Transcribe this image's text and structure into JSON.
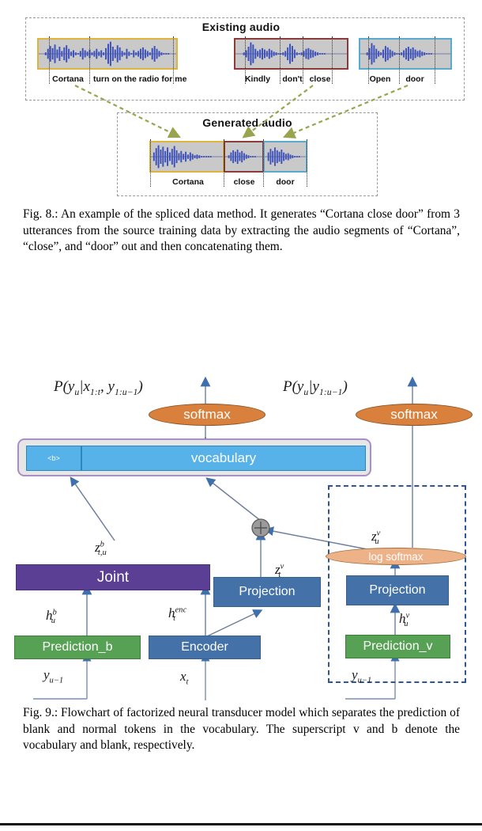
{
  "figure8": {
    "existing_audio": {
      "title": "Existing audio",
      "clips": [
        {
          "id": "clip-cortana",
          "border_color": "#e0b33c",
          "labels": [
            "Cortana",
            "turn on the radio for me"
          ]
        },
        {
          "id": "clip-kindly",
          "border_color": "#8c3a3a",
          "labels": [
            "Kindly",
            "don't",
            "close"
          ]
        },
        {
          "id": "clip-open",
          "border_color": "#5aa9cf",
          "labels": [
            "Open",
            "door"
          ]
        }
      ]
    },
    "generated_audio": {
      "title": "Generated audio",
      "segments": [
        {
          "id": "seg-cortana",
          "label": "Cortana",
          "border_color": "#e0b33c"
        },
        {
          "id": "seg-close",
          "label": "close",
          "border_color": "#8c3a3a"
        },
        {
          "id": "seg-door",
          "label": "door",
          "border_color": "#5aa9cf"
        }
      ]
    },
    "caption": "Fig. 8.: An example of the spliced data method. It generates “Cortana close door” from 3 utterances from the source training data by extracting the audio segments of “Cortana”, “close”, and “door” out and then concatenating them."
  },
  "figure9": {
    "nodes": {
      "softmax_left": "softmax",
      "softmax_right": "softmax",
      "log_softmax": "log softmax",
      "vocab_blank": "<b>",
      "vocab_main": "vocabulary",
      "joint": "Joint",
      "projection_mid": "Projection",
      "projection_right": "Projection",
      "prediction_b": "Prediction_b",
      "encoder": "Encoder",
      "prediction_v": "Prediction_v"
    },
    "math_labels": {
      "prob_left": "P(y_u|x_1:t, y_1:u-1)",
      "prob_right": "P(y_u|y_1:u-1)",
      "z_blank": "z_{t,u}^{b}",
      "z_vt": "z_t^{v}",
      "z_vu": "z_u^{v}",
      "h_b": "h_u^{b}",
      "h_enc": "h_t^{enc}",
      "h_v": "h_u^{v}",
      "y_prev_left": "y_{u-1}",
      "x_t": "x_t",
      "y_prev_right": "y_{u-1}"
    },
    "colors": {
      "blue_box": "#4472a8",
      "green_box": "#56a153",
      "purple_box": "#5b3f95",
      "orange_ellipse": "#d9813c",
      "light_orange_ellipse": "#eeb288",
      "vocab_cell": "#56b2e8",
      "vocab_border": "#a98fc4",
      "dashed_group": "#2f5597",
      "arrow": "#4472a8"
    },
    "caption": "Fig. 9.: Flowchart of factorized neural transducer model which separates the prediction of blank and normal tokens in the vocabulary. The superscript v and b denote the vocabulary and blank, respectively."
  }
}
